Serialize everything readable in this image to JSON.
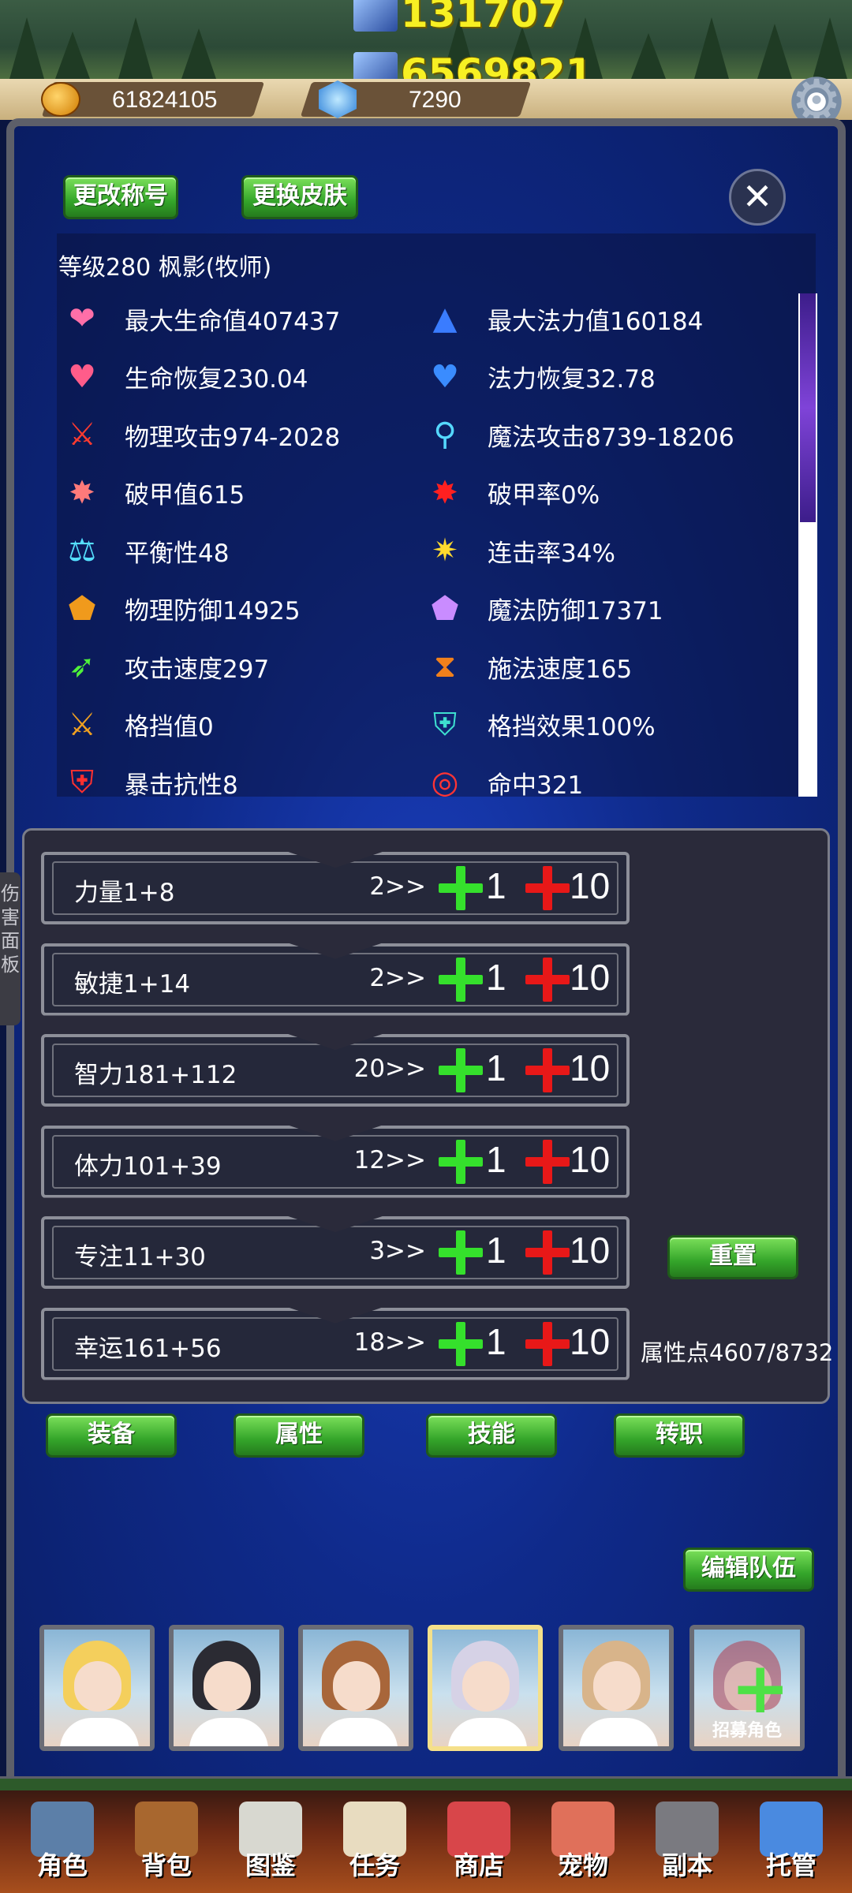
{
  "damage": {
    "top": "131707",
    "bottom": "6569821"
  },
  "resources": {
    "gold": "61824105",
    "gems": "7290"
  },
  "buttons": {
    "change_title": "更改称号",
    "change_skin": "更换皮肤",
    "reset": "重置",
    "edit_team": "编辑队伍"
  },
  "close_glyph": "✕",
  "character": {
    "level_line": "等级280   枫影(牧师)"
  },
  "stats": [
    {
      "text": "最大生命值407437",
      "icon": "heart-icon",
      "glyph": "❤",
      "color": "#ff6fa8"
    },
    {
      "text": "最大法力值160184",
      "icon": "wizard-hat-icon",
      "glyph": "▲",
      "color": "#3a7cff"
    },
    {
      "text": "生命恢复230.04",
      "icon": "health-regen-icon",
      "glyph": "♥",
      "color": "#ff5c8a"
    },
    {
      "text": "法力恢复32.78",
      "icon": "mana-regen-icon",
      "glyph": "♥",
      "color": "#3a8cff"
    },
    {
      "text": "物理攻击974-2028",
      "icon": "sword-icon",
      "glyph": "⚔",
      "color": "#ff3b2f"
    },
    {
      "text": "魔法攻击8739-18206",
      "icon": "magic-wand-icon",
      "glyph": "⚲",
      "color": "#55d8ff"
    },
    {
      "text": "破甲值615",
      "icon": "broken-armor-icon",
      "glyph": "✸",
      "color": "#ff7a7a"
    },
    {
      "text": "破甲率0%",
      "icon": "armor-break-rate-icon",
      "glyph": "✸",
      "color": "#ff2020"
    },
    {
      "text": "平衡性48",
      "icon": "balance-scale-icon",
      "glyph": "⚖",
      "color": "#55dfff"
    },
    {
      "text": "连击率34%",
      "icon": "combo-burst-icon",
      "glyph": "✷",
      "color": "#ffd92e"
    },
    {
      "text": "物理防御14925",
      "icon": "shield-icon",
      "glyph": "⬟",
      "color": "#f09a1c"
    },
    {
      "text": "魔法防御17371",
      "icon": "magic-shield-icon",
      "glyph": "⬟",
      "color": "#c98cff"
    },
    {
      "text": "攻击速度297",
      "icon": "attack-speed-icon",
      "glyph": "➶",
      "color": "#4ff23a"
    },
    {
      "text": "施法速度165",
      "icon": "hourglass-icon",
      "glyph": "⧗",
      "color": "#f0801c"
    },
    {
      "text": "格挡值0",
      "icon": "block-swords-icon",
      "glyph": "⚔",
      "color": "#f0a020"
    },
    {
      "text": "格挡效果100%",
      "icon": "block-effect-icon",
      "glyph": "⛨",
      "color": "#3ee0d0"
    },
    {
      "text": "暴击抗性8",
      "icon": "crit-resist-icon",
      "glyph": "⛨",
      "color": "#ff3030"
    },
    {
      "text": "命中321",
      "icon": "target-icon",
      "glyph": "◎",
      "color": "#ff3434"
    }
  ],
  "attributes": [
    {
      "name": "力量1+8",
      "cost": "2>>"
    },
    {
      "name": "敏捷1+14",
      "cost": "2>>"
    },
    {
      "name": "智力181+112",
      "cost": "20>>"
    },
    {
      "name": "体力101+39",
      "cost": "12>>"
    },
    {
      "name": "专注11+30",
      "cost": "3>>"
    },
    {
      "name": "幸运161+56",
      "cost": "18>>"
    }
  ],
  "attribute_steps": {
    "small": "1",
    "large": "10"
  },
  "attribute_points": "属性点4607/8732",
  "side_tab": [
    "伤",
    "害",
    "面",
    "板"
  ],
  "tabs": [
    {
      "label": "装备"
    },
    {
      "label": "属性"
    },
    {
      "label": "技能"
    },
    {
      "label": "转职"
    }
  ],
  "team": {
    "members": [
      {
        "hair": "#f4cf5c"
      },
      {
        "hair": "#2b2b33"
      },
      {
        "hair": "#a8663a"
      },
      {
        "hair": "#d6d2e6"
      },
      {
        "hair": "#d8b48a"
      }
    ],
    "recruit_label": "招募角色"
  },
  "nav": [
    {
      "label": "角色",
      "icon": "knight-helmet-icon",
      "color": "#5c7fa8"
    },
    {
      "label": "背包",
      "icon": "backpack-icon",
      "color": "#a8672f"
    },
    {
      "label": "图鉴",
      "icon": "book-icon",
      "color": "#d8d8d0"
    },
    {
      "label": "任务",
      "icon": "scroll-icon",
      "color": "#e8dcc0"
    },
    {
      "label": "商店",
      "icon": "shop-icon",
      "color": "#d8464a"
    },
    {
      "label": "宠物",
      "icon": "meat-icon",
      "color": "#e0705a"
    },
    {
      "label": "副本",
      "icon": "skull-dungeon-icon",
      "color": "#7a7a80"
    },
    {
      "label": "托管",
      "icon": "calendar-icon",
      "color": "#4a8ae0"
    }
  ]
}
